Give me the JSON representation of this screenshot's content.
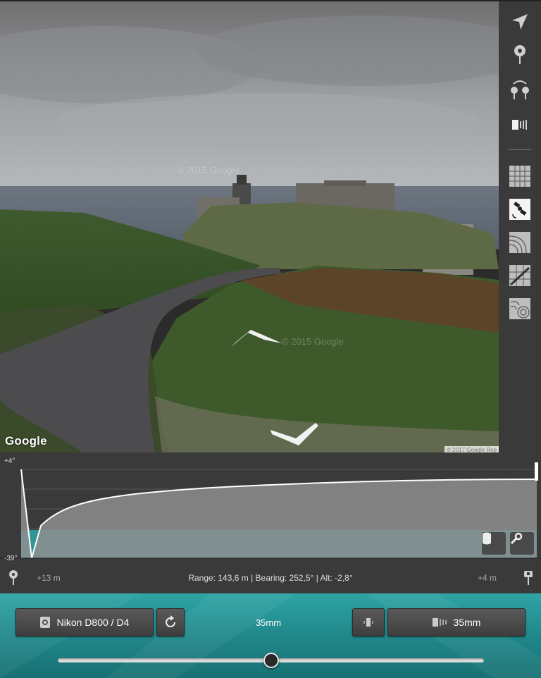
{
  "street_view": {
    "watermark_1": "© 2015 Google",
    "watermark_2": "© 2015 Google",
    "google_logo": "Google",
    "copyright": "© 2017 Google",
    "report_link": "Rep"
  },
  "sidebar": {
    "icons": [
      "location-arrow-icon",
      "map-pin-icon",
      "pins-swap-icon",
      "camera-frame-icon",
      "grid-overlay-icon",
      "satellite-icon",
      "contour-icon",
      "terrain-grid-icon",
      "topo-map-icon"
    ]
  },
  "profile": {
    "top_angle": "+4°",
    "bottom_angle": "-39°",
    "range_text": "Range: 143,6 m | Bearing: 252,5° | Alt: -2,8°",
    "left_distance": "+13 m",
    "right_distance": "+4 m",
    "colors": {
      "fill": "#8e8e8e",
      "band": "#2f9a9b",
      "line": "#ffffff"
    }
  },
  "bottom_bar": {
    "camera_label": "Nikon D800 / D4",
    "focal_text": "35mm",
    "lens_label": "35mm",
    "focal_slider_value": 0.5,
    "colors": {
      "accent": "#2fa4a6"
    }
  }
}
